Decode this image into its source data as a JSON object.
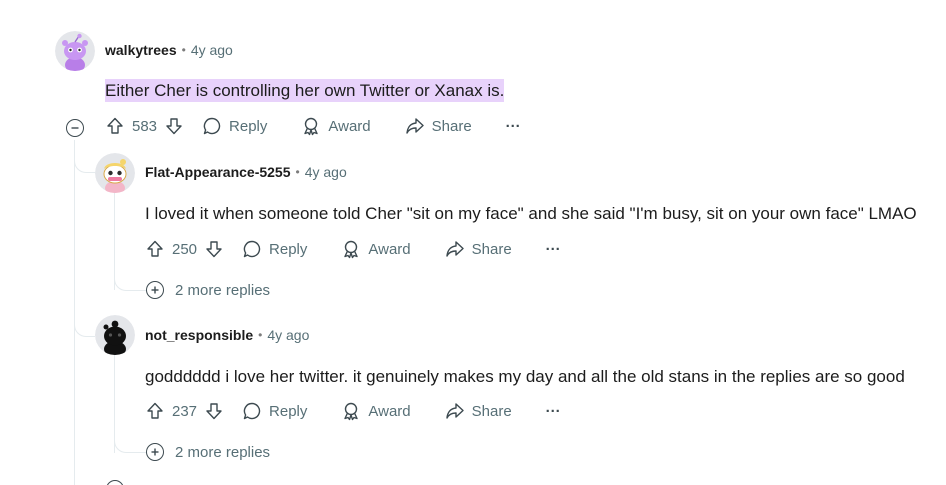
{
  "comments": [
    {
      "username": "walkytrees",
      "separator": "•",
      "time": "4y ago",
      "body": "Either Cher is controlling her own Twitter or Xanax is.",
      "votes": "583",
      "reply_label": "Reply",
      "award_label": "Award",
      "share_label": "Share",
      "more_label": "···"
    },
    {
      "username": "Flat-Appearance-5255",
      "separator": "•",
      "time": "4y ago",
      "body": "I loved it when someone told Cher \"sit on my face\" and she said \"I'm busy, sit on your own face\" LMAO",
      "votes": "250",
      "reply_label": "Reply",
      "award_label": "Award",
      "share_label": "Share",
      "more_label": "···",
      "more_replies": "2 more replies"
    },
    {
      "username": "not_responsible",
      "separator": "•",
      "time": "4y ago",
      "body": "godddddd i love her twitter. it genuinely makes my day and all the old stans in the replies are so good",
      "votes": "237",
      "reply_label": "Reply",
      "award_label": "Award",
      "share_label": "Share",
      "more_label": "···",
      "more_replies": "2 more replies"
    }
  ],
  "colors": {
    "highlight": "#e8d2fb",
    "meta_gray": "#576f76",
    "thread_line": "#e5ebee"
  },
  "icons": [
    "snoo-avatar-icon",
    "upvote-icon",
    "downvote-icon",
    "comment-icon",
    "award-icon",
    "share-icon",
    "collapse-icon",
    "expand-icon"
  ]
}
